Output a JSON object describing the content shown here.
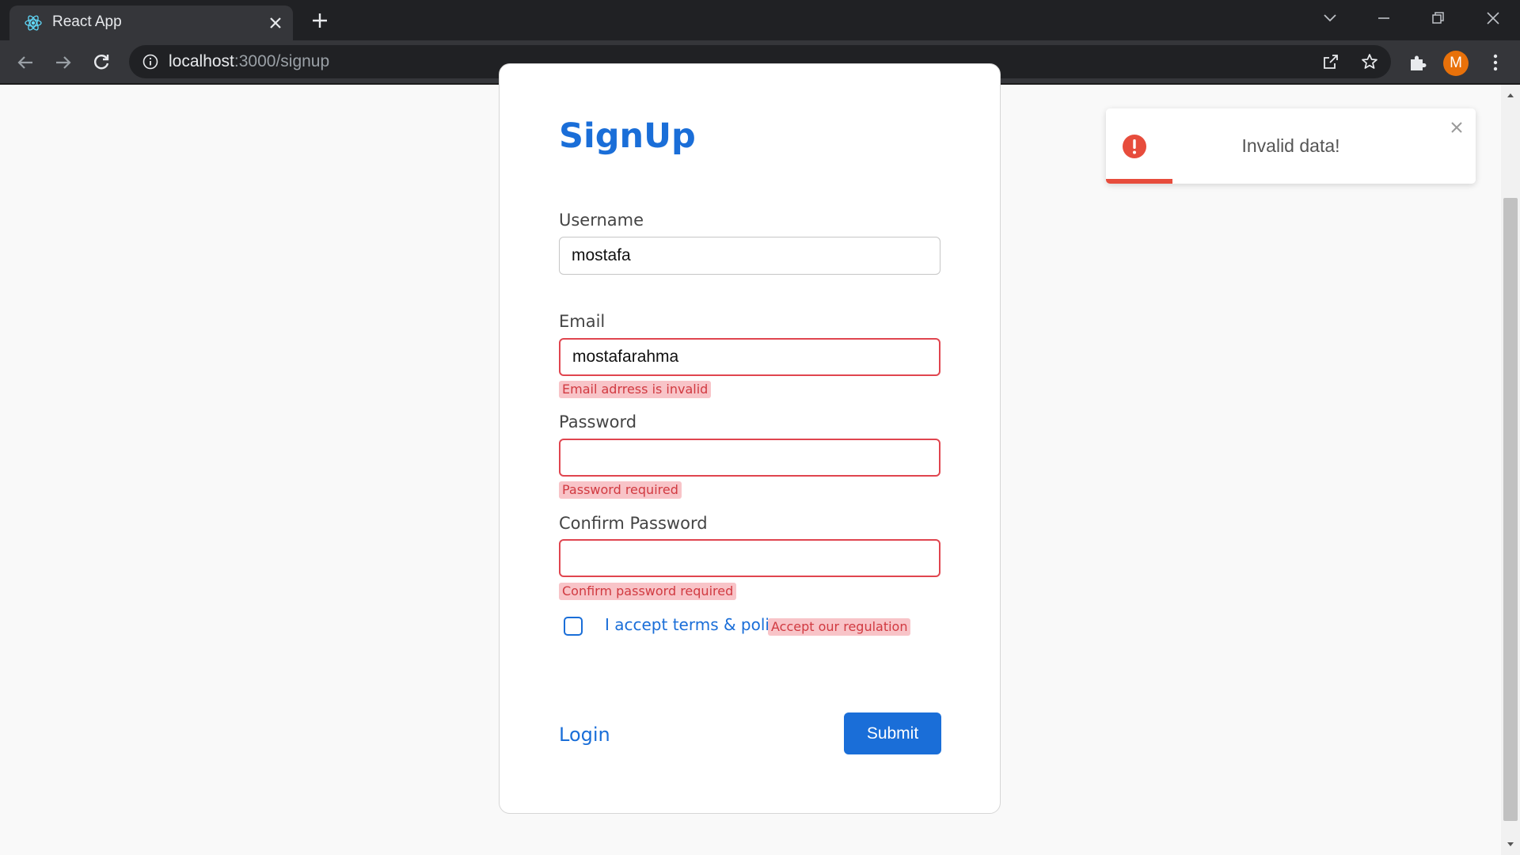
{
  "browser": {
    "tab_title": "React App",
    "url_host": "localhost",
    "url_path": ":3000/signup",
    "profile_initial": "M",
    "profile_color": "#e8710a"
  },
  "page": {
    "title": "SignUp",
    "fields": {
      "username": {
        "label": "Username",
        "value": "mostafa"
      },
      "email": {
        "label": "Email",
        "value": "mostafarahma",
        "error": "Email adrress is invalid"
      },
      "password": {
        "label": "Password",
        "value": "",
        "error": "Password required"
      },
      "confirm_password": {
        "label": "Confirm Password",
        "value": "",
        "error": "Confirm password required"
      }
    },
    "terms": {
      "label": "I accept terms & policy",
      "checked": false,
      "error": "Accept our regulation"
    },
    "login_label": "Login",
    "submit_label": "Submit"
  },
  "toast": {
    "message": "Invalid data!",
    "type": "error",
    "progress_fraction": 0.18
  },
  "colors": {
    "primary": "#1a6ed8",
    "error_border": "#e0454f",
    "error_bg": "#f8c4c8",
    "error_text": "#d13a41",
    "toast_error": "#e74c3c"
  }
}
